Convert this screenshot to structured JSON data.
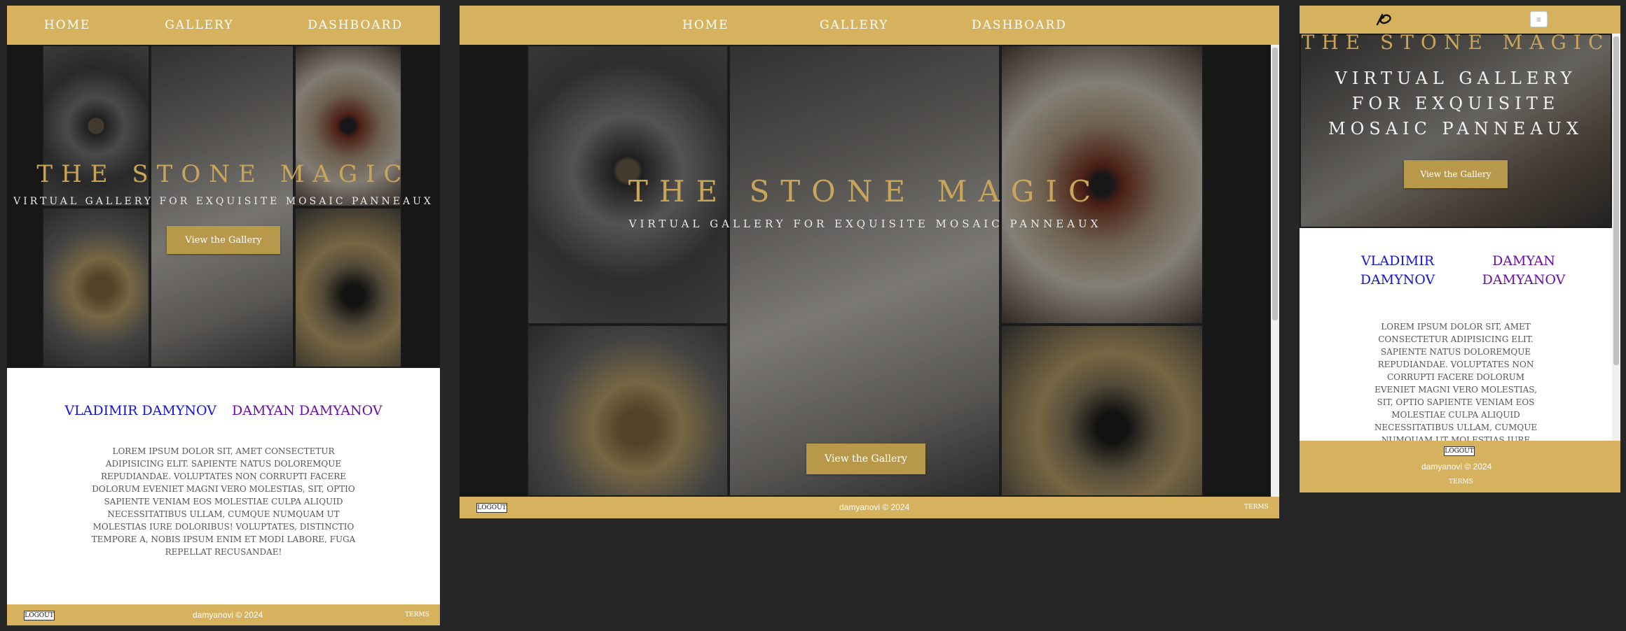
{
  "nav": {
    "home": "Home",
    "gallery": "Gallery",
    "dashboard": "Dashboard"
  },
  "hero": {
    "title": "The Stone Magic",
    "subtitle": "Virtual gallery for exquisite mosaic panneaux",
    "button": "View the Gallery"
  },
  "artists": {
    "first": "Vladimir Damynov",
    "second": "Damyan Damyanov"
  },
  "lorem": "Lorem ipsum dolor sit, amet consectetur adipisicing elit. Sapiente natus doloremque repudiandae. Voluptates non corrupti facere dolorum eveniet magni vero molestias, sit, optio sapiente veniam eos molestiae culpa aliquid necessitatibus ullam, cumque numquam ut molestias iure doloribus! Voluptates, distinctio tempore a, nobis ipsum enim et modi labore, fuga repellat recusandae!",
  "lorem_mobile": "Lorem ipsum dolor sit, amet consectetur adipisicing elit. Sapiente natus doloremque repudiandae. Voluptates non corrupti facere dolorum eveniet magni vero molestias, sit, optio sapiente veniam eos molestiae culpa aliquid necessitatibus ullam, cumque numquam ut molestias iure doloribus!",
  "footer": {
    "logout": "Logout",
    "copyright": "damyanovi © 2024",
    "terms": "Terms"
  },
  "mobile": {
    "menu_icon": "≡"
  },
  "colors": {
    "gold": "#d6b25e",
    "button": "#b8994b",
    "title": "#c9a55a",
    "name_blue": "#1414d6",
    "name_purple": "#6a0dad"
  }
}
